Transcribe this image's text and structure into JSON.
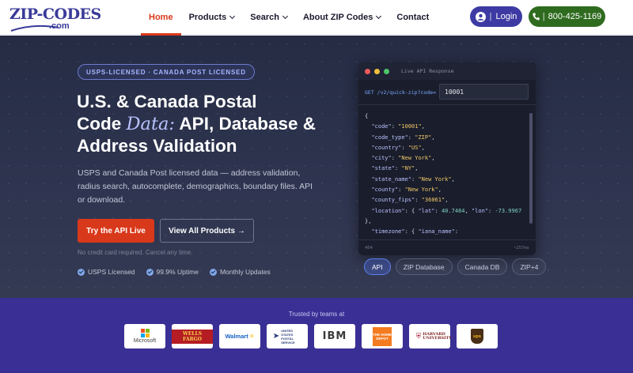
{
  "header": {
    "logo": {
      "word": "ZIP-CODES",
      "tld": ".com"
    },
    "nav": [
      {
        "label": "Home",
        "active": true,
        "dropdown": false
      },
      {
        "label": "Products",
        "active": false,
        "dropdown": true
      },
      {
        "label": "Search",
        "active": false,
        "dropdown": true
      },
      {
        "label": "About ZIP Codes",
        "active": false,
        "dropdown": true
      },
      {
        "label": "Contact",
        "active": false,
        "dropdown": false
      }
    ],
    "login_label": "Login",
    "phone_label": "800-425-1169",
    "separator": "|"
  },
  "hero": {
    "badge": "USPS-LICENSED · CANADA POST LICENSED",
    "title_line1": "U.S. & Canada Postal",
    "title_code": "Code ",
    "title_script": "Data:",
    "title_rest": " API, Database &",
    "title_line3": "Address Validation",
    "description": "USPS and Canada Post licensed data — address validation, radius search, autocomplete, demographics, boundary files. API or download.",
    "cta_primary": "Try the API Live",
    "cta_secondary": "View All Products →",
    "note": "No credit card required. Cancel any time.",
    "badges": [
      "USPS Licensed",
      "99.9% Uptime",
      "Monthly Updates"
    ]
  },
  "api_panel": {
    "title": "Live API Response",
    "request_label": "GET /v2/quick-zip?code=",
    "request_value": "10001",
    "code_lines": [
      "{",
      "  \"code\": \"10001\",",
      "  \"code_type\": \"ZIP\",",
      "  \"country\": \"US\",",
      "  \"city\": \"New York\",",
      "  \"state\": \"NY\",",
      "  \"state_name\": \"New York\",",
      "  \"county\": \"New York\",",
      "  \"county_fips\": \"36061\",",
      "  \"location\": { \"lat\": 40.7484, \"lon\": -73.9967",
      "},",
      "  \"timezone\": { \"iana_name\":"
    ],
    "status": "404",
    "latency": "~257ms",
    "tabs": [
      {
        "label": "API",
        "active": true
      },
      {
        "label": "ZIP Database",
        "active": false
      },
      {
        "label": "Canada DB",
        "active": false
      },
      {
        "label": "ZIP+4",
        "active": false
      }
    ]
  },
  "trusted": {
    "title": "Trusted by teams at",
    "logos": [
      {
        "name": "Microsoft",
        "icon": "microsoft-logo"
      },
      {
        "name": "WELLS FARGO",
        "icon": "wells-fargo-logo"
      },
      {
        "name": "Walmart",
        "icon": "walmart-logo"
      },
      {
        "name": "UNITED STATES POSTAL SERVICE",
        "icon": "usps-logo"
      },
      {
        "name": "IBM",
        "icon": "ibm-logo"
      },
      {
        "name": "THE HOME DEPOT",
        "icon": "home-depot-logo"
      },
      {
        "name": "HARVARD UNIVERSITY",
        "icon": "harvard-logo"
      },
      {
        "name": "ups",
        "icon": "ups-logo"
      }
    ]
  },
  "colors": {
    "accent_red": "#d9391b",
    "login_purple": "#3d3aa3",
    "phone_green": "#2f6b1f",
    "hero_bg": "#2b3147",
    "trusted_bg": "#3a2f95"
  }
}
